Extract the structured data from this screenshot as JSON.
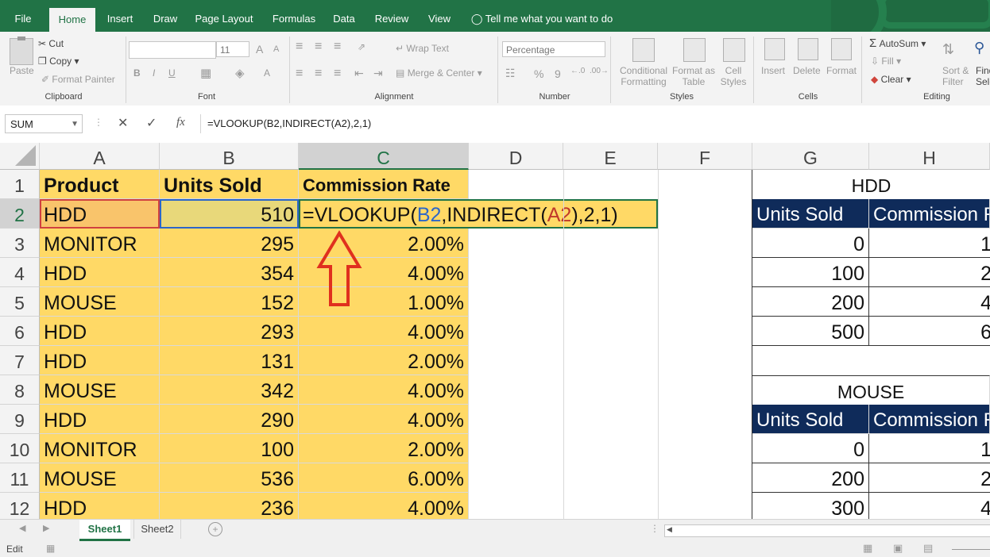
{
  "ribbon_tabs": [
    "File",
    "Home",
    "Insert",
    "Draw",
    "Page Layout",
    "Formulas",
    "Data",
    "Review",
    "View"
  ],
  "tell_me": "Tell me what you want to do",
  "clipboard": {
    "paste": "Paste",
    "cut": "Cut",
    "copy": "Copy",
    "format_painter": "Format Painter",
    "label": "Clipboard"
  },
  "font": {
    "size": "11",
    "bold": "B",
    "italic": "I",
    "underline": "U",
    "grow": "A",
    "shrink": "A",
    "color": "A",
    "label": "Font"
  },
  "alignment": {
    "wrap": "Wrap Text",
    "merge": "Merge & Center",
    "label": "Alignment"
  },
  "number": {
    "format": "Percentage",
    "percent": "%",
    "comma": "9",
    "label": "Number"
  },
  "styles": {
    "conditional": "Conditional",
    "formatting": "Formatting",
    "format_as": "Format as",
    "table": "Table",
    "cell": "Cell",
    "styles_btn": "Styles",
    "label": "Styles"
  },
  "cells": {
    "insert": "Insert",
    "delete": "Delete",
    "format": "Format",
    "label": "Cells"
  },
  "editing": {
    "autosum": "AutoSum",
    "fill": "Fill",
    "clear": "Clear",
    "sort1": "Sort &",
    "sort2": "Filter",
    "find1": "Find",
    "find2": "Sele",
    "label": "Editing"
  },
  "formula_bar": {
    "name_box": "SUM",
    "formula": "=VLOOKUP(B2,INDIRECT(A2),2,1)",
    "fx": "fx"
  },
  "columns": [
    "A",
    "B",
    "C",
    "D",
    "E",
    "F",
    "G",
    "H"
  ],
  "rows": [
    "1",
    "2",
    "3",
    "4",
    "5",
    "6",
    "7",
    "8",
    "9",
    "10",
    "11",
    "12"
  ],
  "table": {
    "headers": [
      "Product",
      "Units Sold",
      "Commission Rate"
    ],
    "data": [
      [
        "HDD",
        "510",
        ""
      ],
      [
        "MONITOR",
        "295",
        "2.00%"
      ],
      [
        "HDD",
        "354",
        "4.00%"
      ],
      [
        "MOUSE",
        "152",
        "1.00%"
      ],
      [
        "HDD",
        "293",
        "4.00%"
      ],
      [
        "HDD",
        "131",
        "2.00%"
      ],
      [
        "MOUSE",
        "342",
        "4.00%"
      ],
      [
        "HDD",
        "290",
        "4.00%"
      ],
      [
        "MONITOR",
        "100",
        "2.00%"
      ],
      [
        "MOUSE",
        "536",
        "6.00%"
      ],
      [
        "HDD",
        "236",
        "4.00%"
      ]
    ],
    "edit_formula": {
      "prefix": "=VLOOKUP(",
      "ref1": "B2",
      "mid": ",INDIRECT(",
      "ref2": "A2",
      "suffix": "),2,1)"
    }
  },
  "lookup_hdd": {
    "title": "HDD",
    "h1": "Units Sold",
    "h2": "Commission R",
    "rows": [
      [
        "0",
        "1"
      ],
      [
        "100",
        "2"
      ],
      [
        "200",
        "4"
      ],
      [
        "500",
        "6"
      ]
    ]
  },
  "lookup_mouse": {
    "title": "MOUSE",
    "h1": "Units Sold",
    "h2": "Commission R",
    "rows": [
      [
        "0",
        "1"
      ],
      [
        "200",
        "2"
      ],
      [
        "300",
        "4"
      ]
    ]
  },
  "sheets": [
    "Sheet1",
    "Sheet2"
  ],
  "status": {
    "mode": "Edit"
  },
  "colors": {
    "excel_green": "#217346",
    "highlight": "#ffd966",
    "navy": "#0f2b5a",
    "arrow": "#e0301e"
  }
}
